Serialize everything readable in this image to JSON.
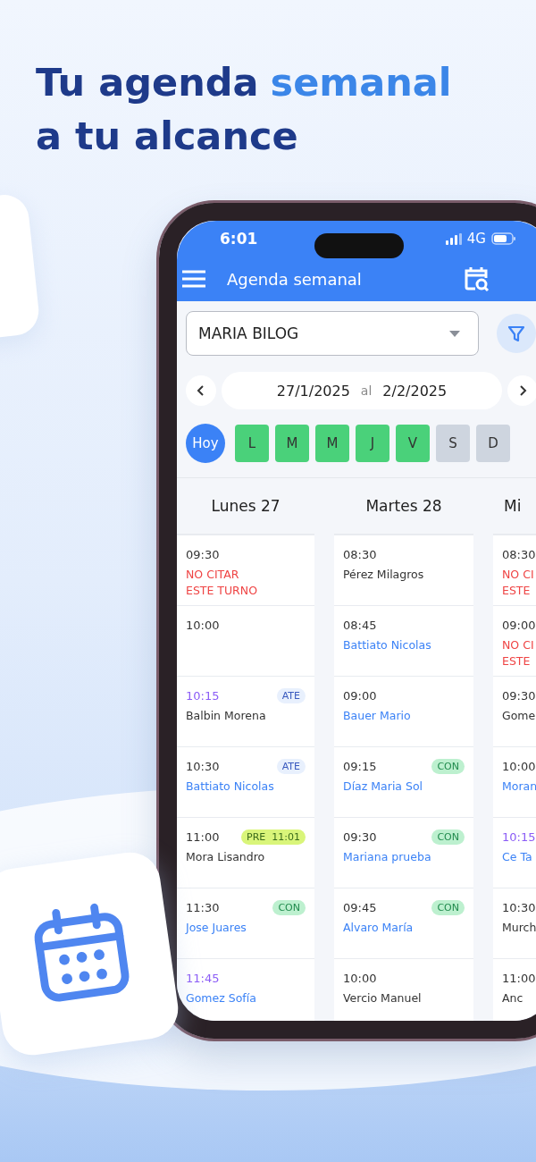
{
  "headline": [
    [
      {
        "text": "Tu agenda",
        "accent": false
      },
      {
        "text": "semanal",
        "accent": true
      }
    ],
    [
      {
        "text": "a tu alcance",
        "accent": false
      }
    ]
  ],
  "status_bar": {
    "time": "6:01",
    "network": "4G"
  },
  "app_bar": {
    "title": "Agenda semanal"
  },
  "professional_select": {
    "value": "MARIA BILOG"
  },
  "date_range": {
    "from": "27/1/2025",
    "separator": "al",
    "to": "2/2/2025"
  },
  "today_button": {
    "label": "Hoy",
    "selected": true
  },
  "days": [
    {
      "label": "L",
      "active": true
    },
    {
      "label": "M",
      "active": true
    },
    {
      "label": "M",
      "active": true
    },
    {
      "label": "J",
      "active": true
    },
    {
      "label": "V",
      "active": true
    },
    {
      "label": "S",
      "active": false
    },
    {
      "label": "D",
      "active": false
    }
  ],
  "columns": [
    {
      "header": "Lunes 27",
      "entries": [
        {
          "time": "09:30",
          "highlighted": false,
          "kind": "blocked",
          "lines": [
            "NO CITAR",
            "ESTE TURNO"
          ]
        },
        {
          "time": "10:00",
          "highlighted": false
        },
        {
          "time": "10:15",
          "highlighted": true,
          "kind": "plain",
          "lines": [
            "Balbin Morena"
          ],
          "badge": {
            "label": "ATE",
            "kind": "ate"
          }
        },
        {
          "time": "10:30",
          "highlighted": false,
          "kind": "link",
          "lines": [
            "Battiato Nicolas"
          ],
          "badge": {
            "label": "ATE",
            "kind": "ate"
          }
        },
        {
          "time": "11:00",
          "highlighted": false,
          "kind": "plain",
          "lines": [
            "Mora Lisandro"
          ],
          "badge": {
            "label": "PRE  11:01",
            "kind": "pre"
          }
        },
        {
          "time": "11:30",
          "highlighted": false,
          "kind": "link",
          "lines": [
            "Jose Juares"
          ],
          "badge": {
            "label": "CON",
            "kind": "con"
          }
        },
        {
          "time": "11:45",
          "highlighted": true,
          "kind": "link",
          "lines": [
            "Gomez Sofía"
          ]
        }
      ]
    },
    {
      "header": "Martes 28",
      "entries": [
        {
          "time": "08:30",
          "highlighted": false,
          "kind": "plain",
          "lines": [
            "Pérez Milagros"
          ]
        },
        {
          "time": "08:45",
          "highlighted": false,
          "kind": "link",
          "lines": [
            "Battiato Nicolas"
          ]
        },
        {
          "time": "09:00",
          "highlighted": false,
          "kind": "link",
          "lines": [
            "Bauer Mario"
          ]
        },
        {
          "time": "09:15",
          "highlighted": false,
          "kind": "link",
          "lines": [
            "Díaz Maria Sol"
          ],
          "badge": {
            "label": "CON",
            "kind": "con"
          }
        },
        {
          "time": "09:30",
          "highlighted": false,
          "kind": "link",
          "lines": [
            "Mariana prueba"
          ],
          "badge": {
            "label": "CON",
            "kind": "con"
          }
        },
        {
          "time": "09:45",
          "highlighted": false,
          "kind": "link",
          "lines": [
            "Alvaro María"
          ],
          "badge": {
            "label": "CON",
            "kind": "con"
          }
        },
        {
          "time": "10:00",
          "highlighted": false,
          "kind": "plain",
          "lines": [
            "Vercio Manuel"
          ]
        }
      ]
    },
    {
      "header": "Mi",
      "entries": [
        {
          "time": "08:30",
          "highlighted": false,
          "kind": "blocked",
          "lines": [
            "NO CI",
            "ESTE"
          ]
        },
        {
          "time": "09:00",
          "highlighted": false,
          "kind": "blocked",
          "lines": [
            "NO CI",
            "ESTE"
          ]
        },
        {
          "time": "09:30",
          "highlighted": false,
          "kind": "plain",
          "lines": [
            "Gome"
          ]
        },
        {
          "time": "10:00",
          "highlighted": false,
          "kind": "link",
          "lines": [
            "Moran"
          ]
        },
        {
          "time": "10:15",
          "highlighted": true,
          "kind": "link",
          "lines": [
            "Ce Ta"
          ]
        },
        {
          "time": "10:30",
          "highlighted": false,
          "kind": "plain",
          "lines": [
            "Murch"
          ]
        },
        {
          "time": "11:00",
          "highlighted": false,
          "kind": "plain",
          "lines": [
            "Anc"
          ]
        }
      ]
    }
  ]
}
